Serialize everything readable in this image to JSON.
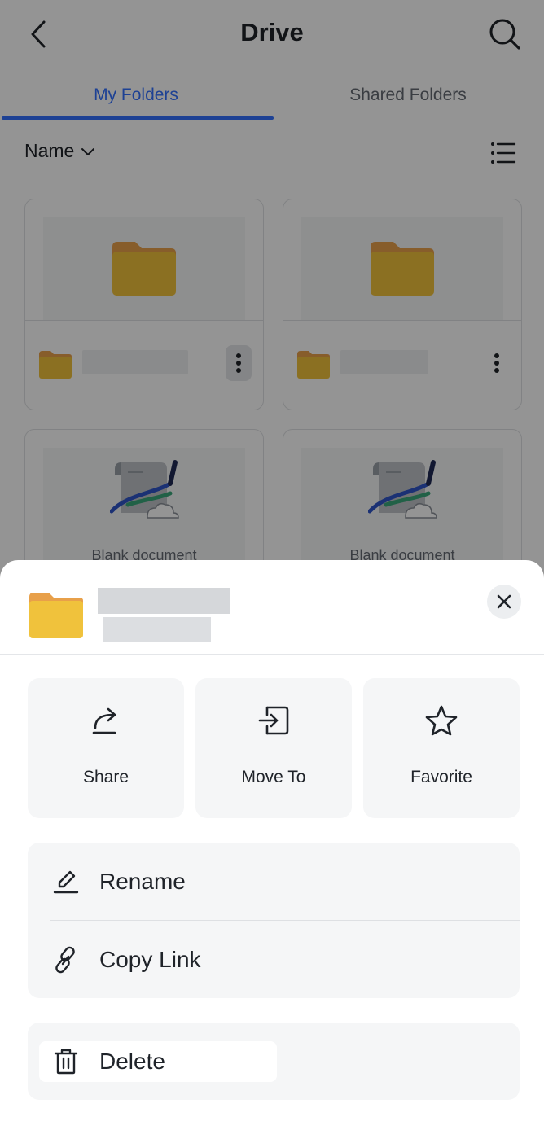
{
  "header": {
    "title": "Drive"
  },
  "tabs": [
    {
      "label": "My Folders",
      "active": true
    },
    {
      "label": "Shared Folders",
      "active": false
    }
  ],
  "sort": {
    "label": "Name"
  },
  "cards": [
    {
      "kind": "folder"
    },
    {
      "kind": "folder"
    },
    {
      "kind": "document",
      "caption": "Blank document"
    },
    {
      "kind": "document",
      "caption": "Blank document"
    }
  ],
  "sheet": {
    "actions": [
      {
        "label": "Share",
        "icon": "share-icon"
      },
      {
        "label": "Move To",
        "icon": "move-to-icon"
      },
      {
        "label": "Favorite",
        "icon": "star-icon"
      }
    ],
    "list": [
      {
        "label": "Rename",
        "icon": "pencil-icon"
      },
      {
        "label": "Copy Link",
        "icon": "link-icon"
      }
    ],
    "delete": {
      "label": "Delete",
      "icon": "trash-icon"
    }
  },
  "colors": {
    "accent": "#3370ff",
    "folder_body": "#f0c23c",
    "folder_tab": "#e8a04a",
    "overlay": "rgba(0,0,0,0.42)"
  }
}
